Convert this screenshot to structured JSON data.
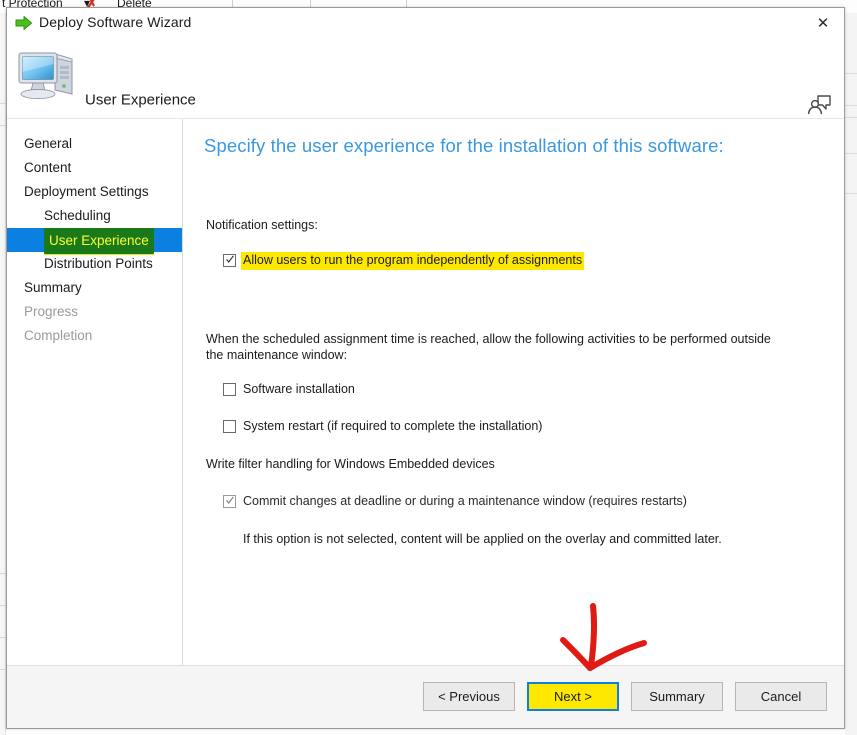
{
  "background": {
    "ribbon": {
      "item1_label": "t Protection",
      "item1_caret": "▾",
      "item2_label": "Delete",
      "delete_icon": "red-x-icon"
    }
  },
  "dialog": {
    "title": "Deploy Software Wizard",
    "title_icon": "green-arrow-icon",
    "close_label": "✕",
    "close_icon": "close-icon",
    "header": {
      "title": "User Experience",
      "icon": "computer-icon",
      "help_icon": "feedback-person-icon"
    },
    "sidebar": {
      "items": [
        {
          "label": "General",
          "level": 0,
          "state": "enabled"
        },
        {
          "label": "Content",
          "level": 0,
          "state": "enabled"
        },
        {
          "label": "Deployment Settings",
          "level": 0,
          "state": "enabled"
        },
        {
          "label": "Scheduling",
          "level": 1,
          "state": "enabled"
        },
        {
          "label": "User Experience",
          "level": 1,
          "state": "selected"
        },
        {
          "label": "Distribution Points",
          "level": 1,
          "state": "enabled"
        },
        {
          "label": "Summary",
          "level": 0,
          "state": "enabled"
        },
        {
          "label": "Progress",
          "level": 0,
          "state": "disabled"
        },
        {
          "label": "Completion",
          "level": 0,
          "state": "disabled"
        }
      ]
    },
    "content": {
      "heading": "Specify the user experience for the installation of this software:",
      "notification_label": "Notification settings:",
      "allow_users_checkbox": {
        "label": "Allow users to run the program independently of assignments",
        "checked": true,
        "highlighted": true
      },
      "maintenance_paragraph": "When the scheduled assignment time is reached, allow the following activities to be performed outside the maintenance window:",
      "software_installation_checkbox": {
        "label": "Software installation",
        "checked": false
      },
      "system_restart_checkbox": {
        "label": "System restart (if required to complete the installation)",
        "checked": false
      },
      "write_filter_label": "Write filter handling for Windows Embedded devices",
      "commit_changes_checkbox": {
        "label": "Commit changes at deadline or during a maintenance window (requires restarts)",
        "checked": true
      },
      "overlay_note": "If this option is not selected, content will be applied on the overlay and committed later."
    },
    "footer": {
      "buttons": [
        {
          "label": "< Previous",
          "state": "normal"
        },
        {
          "label": "Next >",
          "state": "highlighted"
        },
        {
          "label": "Summary",
          "state": "normal"
        },
        {
          "label": "Cancel",
          "state": "normal"
        }
      ]
    }
  },
  "annotation": {
    "arrow": "red-down-arrow",
    "color": "#e01b14"
  },
  "colors": {
    "heading_blue": "#3a98e0",
    "selection_blue": "#0c80e0",
    "highlight_yellow": "#ffe800",
    "highlight_green": "#1a7a1a",
    "nav_selected_text": "#ffff33",
    "annotation_red": "#e01b14"
  }
}
